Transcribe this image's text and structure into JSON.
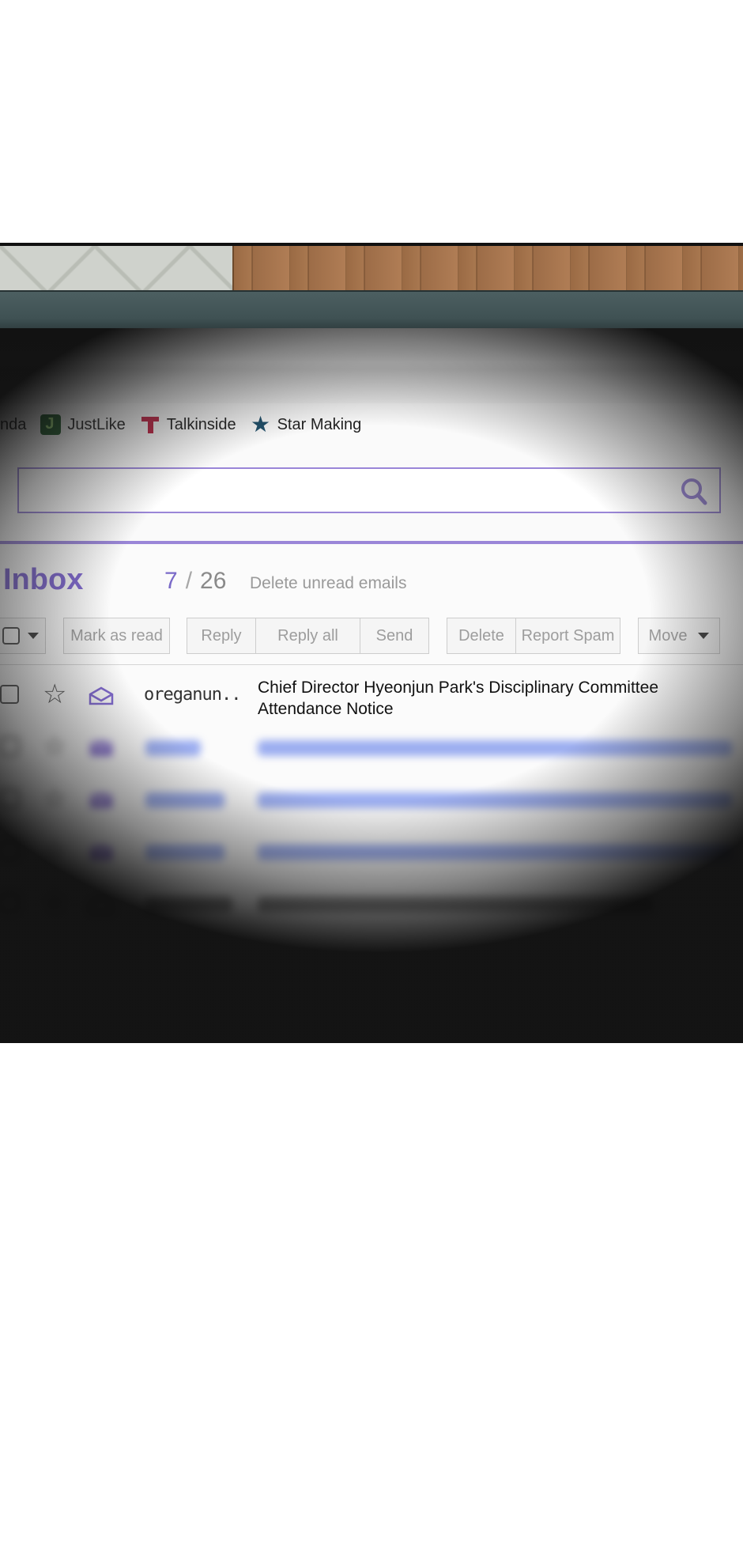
{
  "bookmarks": [
    {
      "label": "nda",
      "icon": "none"
    },
    {
      "label": "JustLike",
      "icon": "justlike-icon"
    },
    {
      "label": "Talkinside",
      "icon": "talkinside-icon"
    },
    {
      "label": "Star Making",
      "icon": "star-icon"
    }
  ],
  "search": {
    "value": "",
    "icon": "search-icon"
  },
  "inbox": {
    "title": "Inbox",
    "unread": "7",
    "separator": "/",
    "total": "26",
    "delete_unread": "Delete unread emails"
  },
  "toolbar": {
    "mark_as_read": "Mark as read",
    "reply": "Reply",
    "reply_all": "Reply all",
    "send": "Send",
    "delete": "Delete",
    "report_spam": "Report Spam",
    "move": "Move"
  },
  "emails": [
    {
      "sender": "oreganun..",
      "subject": "Chief Director Hyeonjun Park's Disciplinary Committee Attendance Notice",
      "read": true
    }
  ],
  "colors": {
    "accent": "#8069cf",
    "border": "#9a86d8",
    "blurred_text": "#4c6de8"
  }
}
